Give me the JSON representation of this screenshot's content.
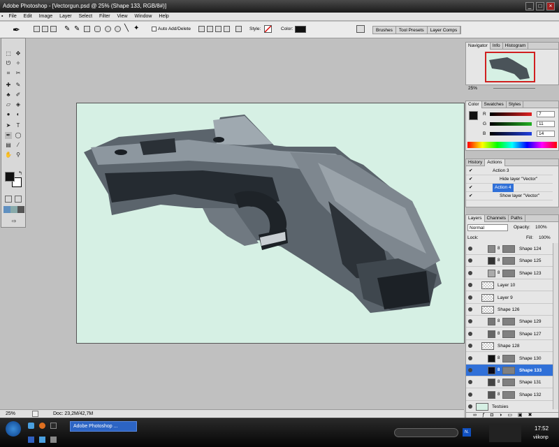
{
  "window": {
    "title": "Adobe Photoshop - [Vectorgun.psd @ 25% (Shape 133, RGB/8#)]"
  },
  "menu": [
    "File",
    "Edit",
    "Image",
    "Layer",
    "Select",
    "Filter",
    "View",
    "Window",
    "Help"
  ],
  "options": {
    "auto_add_delete": "Auto Add/Delete",
    "style_label": "Style:",
    "color_label": "Color:",
    "swatch_color": "#111111",
    "palette_tabs": [
      "Brushes",
      "Tool Presets",
      "Layer Comps"
    ]
  },
  "status": {
    "zoom": "25%",
    "doc": "Doc: 23,2M/42,7M"
  },
  "navigator": {
    "tabs": [
      "Navigator",
      "Info",
      "Histogram"
    ],
    "zoom": "25%"
  },
  "color_panel": {
    "tabs": [
      "Color",
      "Swatches",
      "Styles"
    ],
    "channels": [
      {
        "label": "R",
        "value": "7",
        "color": "#e02020"
      },
      {
        "label": "G",
        "value": "11",
        "color": "#20b020"
      },
      {
        "label": "B",
        "value": "14",
        "color": "#2040e0"
      }
    ]
  },
  "actions": {
    "tabs": [
      "History",
      "Actions"
    ],
    "items": [
      "Action 3",
      "Hide layer \"Vector\"",
      "Action 4",
      "Show layer \"Vector\""
    ],
    "selected_index": 2
  },
  "layers": {
    "tabs": [
      "Layers",
      "Channels",
      "Paths"
    ],
    "blend_mode": "Normal",
    "opacity_label": "Opacity:",
    "opacity": "100%",
    "lock_label": "Lock:",
    "fill_label": "Fill:",
    "fill": "100%",
    "selected": "Shape 133",
    "rows": [
      {
        "name": "Shape 124",
        "type": "shape",
        "color": "#888888"
      },
      {
        "name": "Shape 125",
        "type": "shape",
        "color": "#333333"
      },
      {
        "name": "Shape 123",
        "type": "shape",
        "color": "#aaaaaa"
      },
      {
        "name": "Layer 10",
        "type": "raster"
      },
      {
        "name": "Layer 9",
        "type": "raster"
      },
      {
        "name": "Shape 126",
        "type": "raster"
      },
      {
        "name": "Shape 129",
        "type": "shape",
        "color": "#777777"
      },
      {
        "name": "Shape 127",
        "type": "shape",
        "color": "#666666"
      },
      {
        "name": "Shape 128",
        "type": "raster"
      },
      {
        "name": "Shape 130",
        "type": "shape",
        "color": "#111111"
      },
      {
        "name": "Shape 133",
        "type": "shape",
        "color": "#0a0a1a"
      },
      {
        "name": "Shape 131",
        "type": "shape",
        "color": "#444444"
      },
      {
        "name": "Shape 132",
        "type": "shape",
        "color": "#555555"
      },
      {
        "name": "Testsies",
        "type": "background",
        "color": "#d6f0e4"
      }
    ]
  },
  "taskbar": {
    "app_button": "Adobe Photoshop ...",
    "clock": "17:52",
    "day": "viikonp"
  },
  "colors": {
    "canvas_bg": "#d6f0e4",
    "selection": "#3070d8",
    "foreground": "#111111",
    "background": "#ffffff"
  }
}
